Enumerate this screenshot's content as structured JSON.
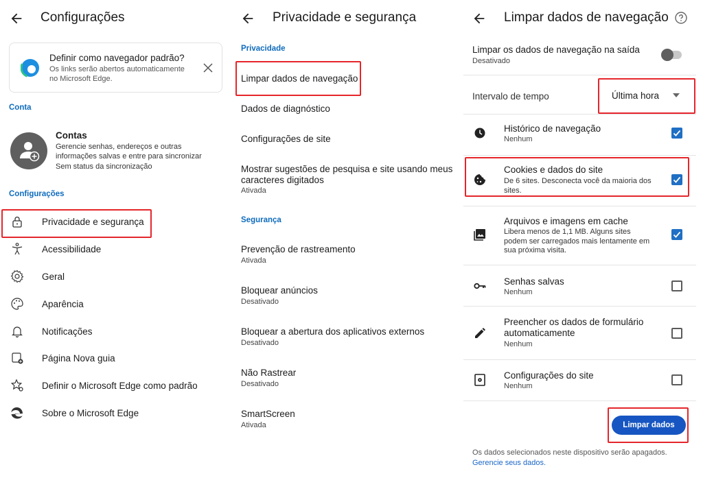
{
  "panel1": {
    "title": "Configurações",
    "default_card": {
      "title": "Definir como navegador padrão?",
      "body": "Os links serão abertos automaticamente\nno Microsoft Edge."
    },
    "section_account": "Conta",
    "account": {
      "title": "Contas",
      "desc": "Gerencie senhas, endereços e outras\ninformações salvas e entre para sincronizar",
      "sync": "Sem status da sincronização"
    },
    "section_settings": "Configurações",
    "items": [
      {
        "label": "Privacidade e segurança",
        "icon": "lock-icon"
      },
      {
        "label": "Acessibilidade",
        "icon": "accessibility-icon"
      },
      {
        "label": "Geral",
        "icon": "gear-icon"
      },
      {
        "label": "Aparência",
        "icon": "palette-icon"
      },
      {
        "label": "Notificações",
        "icon": "bell-icon"
      },
      {
        "label": "Página Nova guia",
        "icon": "new-tab-icon"
      },
      {
        "label": "Definir o Microsoft Edge como padrão",
        "icon": "star-gear-icon"
      },
      {
        "label": "Sobre o Microsoft Edge",
        "icon": "edge-logo-icon"
      }
    ]
  },
  "panel2": {
    "title": "Privacidade e segurança",
    "section_privacy": "Privacidade",
    "privacy_items": [
      {
        "label": "Limpar dados de navegação",
        "sub": ""
      },
      {
        "label": "Dados de diagnóstico",
        "sub": ""
      },
      {
        "label": "Configurações de site",
        "sub": ""
      },
      {
        "label": "Mostrar sugestões de pesquisa e site usando meus\ncaracteres digitados",
        "sub": "Ativada"
      }
    ],
    "section_security": "Segurança",
    "security_items": [
      {
        "label": "Prevenção de rastreamento",
        "sub": "Ativada"
      },
      {
        "label": "Bloquear anúncios",
        "sub": "Desativado"
      },
      {
        "label": "Bloquear a abertura dos aplicativos externos",
        "sub": "Desativado"
      },
      {
        "label": "Não Rastrear",
        "sub": "Desativado"
      },
      {
        "label": "SmartScreen",
        "sub": "Ativada"
      }
    ]
  },
  "panel3": {
    "title": "Limpar dados de navegação",
    "exit": {
      "label": "Limpar os dados de navegação na saída",
      "sub": "Desativado",
      "on": false
    },
    "interval": {
      "label": "Intervalo de tempo",
      "value": "Última hora"
    },
    "options": [
      {
        "label": "Histórico de navegação",
        "sub": "Nenhum",
        "checked": true,
        "icon": "clock-icon"
      },
      {
        "label": "Cookies e dados do site",
        "sub": "De 6 sites. Desconecta você da maioria dos\nsites.",
        "checked": true,
        "icon": "cookie-icon"
      },
      {
        "label": "Arquivos e imagens em cache",
        "sub": "Libera menos de 1,1 MB. Alguns sites\npodem ser carregados mais lentamente em\nsua próxima visita.",
        "checked": true,
        "icon": "image-icon"
      },
      {
        "label": "Senhas salvas",
        "sub": "Nenhum",
        "checked": false,
        "icon": "key-icon"
      },
      {
        "label": "Preencher os dados de formulário\nautomaticamente",
        "sub": "Nenhum",
        "checked": false,
        "icon": "pencil-icon"
      },
      {
        "label": "Configurações do site",
        "sub": "Nenhum",
        "checked": false,
        "icon": "site-settings-icon"
      }
    ],
    "clear_button": "Limpar dados",
    "footer": "Os dados selecionados neste dispositivo serão apagados.",
    "footer_link": "Gerencie seus dados."
  },
  "colors": {
    "accent": "#0f6cbd",
    "button": "#1756c2",
    "highlight": "#e5252a",
    "checkbox": "#1f6fc4"
  }
}
